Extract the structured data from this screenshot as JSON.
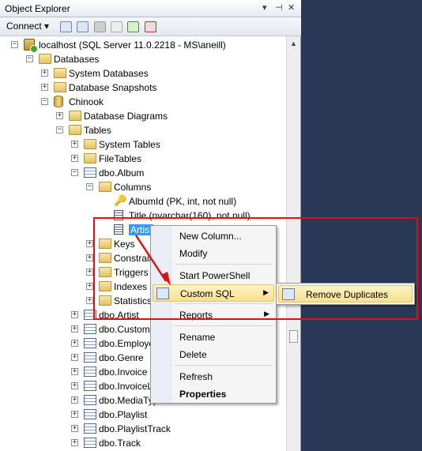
{
  "window": {
    "title": "Object Explorer",
    "controls": [
      "▾",
      "⊣",
      "✕"
    ]
  },
  "toolbar": {
    "connect_label": "Connect ▾"
  },
  "tree": [
    {
      "label": "localhost (SQL Server 11.0.2218 - MS\\aneill)",
      "icon": "server-icon",
      "expander": "−",
      "level": 0
    },
    {
      "label": "Databases",
      "icon": "folder-icon",
      "expander": "−",
      "level": 1
    },
    {
      "label": "System Databases",
      "icon": "folder-icon",
      "expander": "+",
      "level": 2
    },
    {
      "label": "Database Snapshots",
      "icon": "folder-icon",
      "expander": "+",
      "level": 2
    },
    {
      "label": "Chinook",
      "icon": "database-icon",
      "expander": "−",
      "level": 2
    },
    {
      "label": "Database Diagrams",
      "icon": "folder-icon",
      "expander": "+",
      "level": 3
    },
    {
      "label": "Tables",
      "icon": "folder-icon",
      "expander": "−",
      "level": 3
    },
    {
      "label": "System Tables",
      "icon": "folder-icon",
      "expander": "+",
      "level": 4
    },
    {
      "label": "FileTables",
      "icon": "folder-icon",
      "expander": "+",
      "level": 4
    },
    {
      "label": "dbo.Album",
      "icon": "table-icon",
      "expander": "−",
      "level": 4
    },
    {
      "label": "Columns",
      "icon": "folder-icon",
      "expander": "−",
      "level": 5
    },
    {
      "label": "AlbumId (PK, int, not null)",
      "icon": "key-icon",
      "expander": "",
      "level": 6
    },
    {
      "label": "Title (nvarchar(160), not null)",
      "icon": "column-icon",
      "expander": "",
      "level": 6
    },
    {
      "label": "Artist",
      "icon": "column-icon",
      "expander": "",
      "level": 6,
      "selected": true
    },
    {
      "label": "Keys",
      "icon": "folder-icon",
      "expander": "+",
      "level": 5
    },
    {
      "label": "Constraints",
      "icon": "folder-icon",
      "expander": "+",
      "level": 5
    },
    {
      "label": "Triggers",
      "icon": "folder-icon",
      "expander": "+",
      "level": 5
    },
    {
      "label": "Indexes",
      "icon": "folder-icon",
      "expander": "+",
      "level": 5
    },
    {
      "label": "Statistics",
      "icon": "folder-icon",
      "expander": "+",
      "level": 5
    },
    {
      "label": "dbo.Artist",
      "icon": "table-icon",
      "expander": "+",
      "level": 4
    },
    {
      "label": "dbo.Customer",
      "icon": "table-icon",
      "expander": "+",
      "level": 4
    },
    {
      "label": "dbo.Employee",
      "icon": "table-icon",
      "expander": "+",
      "level": 4
    },
    {
      "label": "dbo.Genre",
      "icon": "table-icon",
      "expander": "+",
      "level": 4
    },
    {
      "label": "dbo.Invoice",
      "icon": "table-icon",
      "expander": "+",
      "level": 4
    },
    {
      "label": "dbo.InvoiceLine",
      "icon": "table-icon",
      "expander": "+",
      "level": 4
    },
    {
      "label": "dbo.MediaType",
      "icon": "table-icon",
      "expander": "+",
      "level": 4
    },
    {
      "label": "dbo.Playlist",
      "icon": "table-icon",
      "expander": "+",
      "level": 4
    },
    {
      "label": "dbo.PlaylistTrack",
      "icon": "table-icon",
      "expander": "+",
      "level": 4
    },
    {
      "label": "dbo.Track",
      "icon": "table-icon",
      "expander": "+",
      "level": 4
    }
  ],
  "context_menu": {
    "new_column": "New Column...",
    "modify": "Modify",
    "start_powershell": "Start PowerShell",
    "custom_sql": "Custom SQL",
    "reports": "Reports",
    "rename": "Rename",
    "delete": "Delete",
    "refresh": "Refresh",
    "properties": "Properties",
    "submenu_arrow": "▶"
  },
  "submenu": {
    "remove_duplicates": "Remove Duplicates"
  },
  "colors": {
    "highlight_box": "#e01010",
    "selection": "#3399ff",
    "menu_hover": "#f8e08e"
  }
}
